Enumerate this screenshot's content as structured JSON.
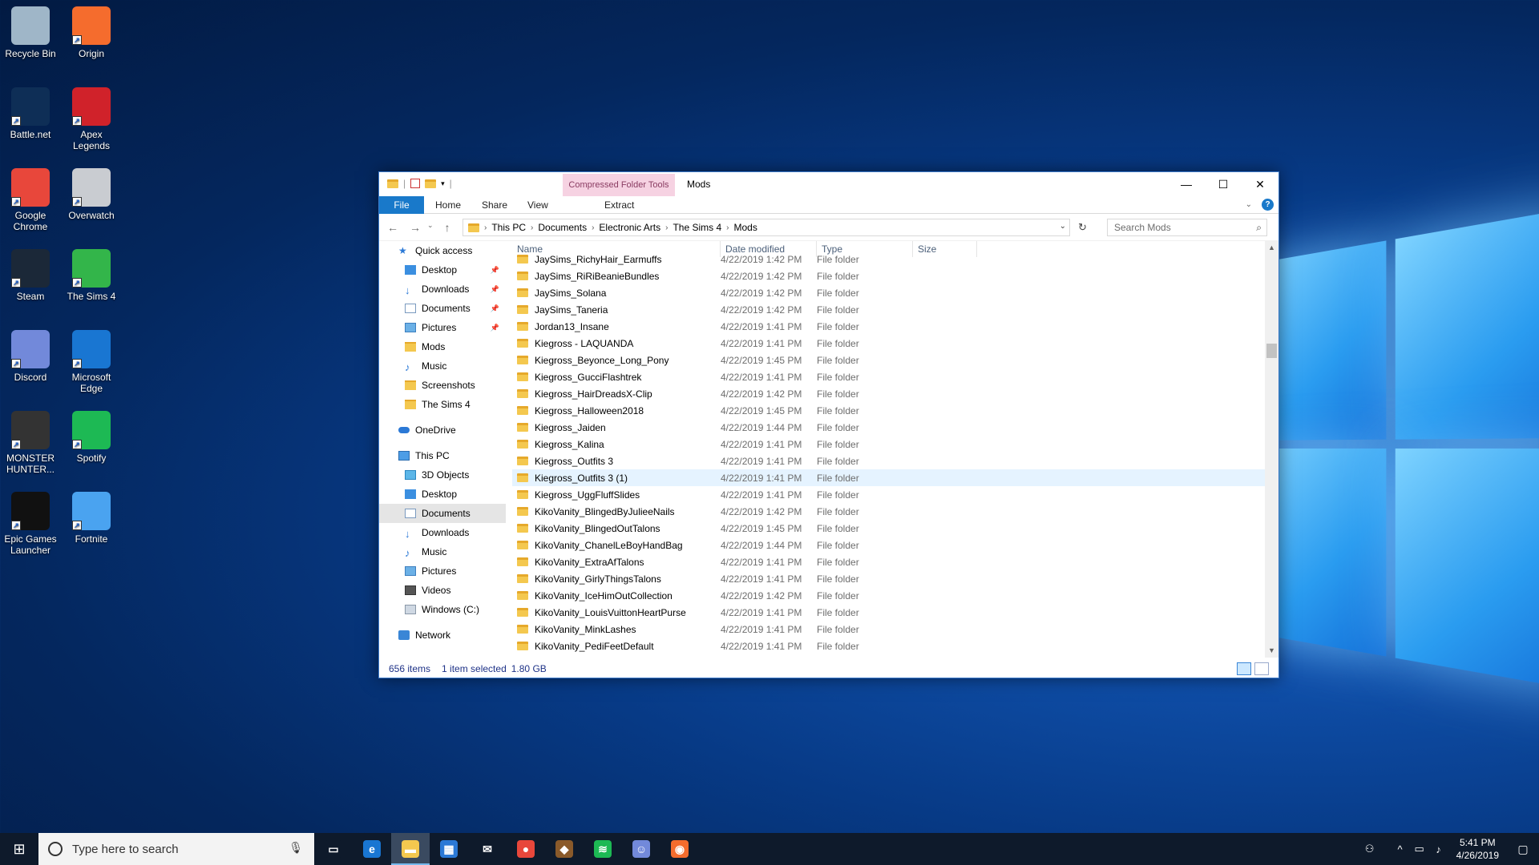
{
  "desktop_icons": [
    {
      "label": "Recycle Bin",
      "icon": "recycle-bin-icon",
      "color": "#9fb6c8"
    },
    {
      "label": "Origin",
      "icon": "origin-icon",
      "color": "#f56c2d"
    },
    {
      "label": "Battle.net",
      "icon": "battlenet-icon",
      "color": "#0e2e56"
    },
    {
      "label": "Apex Legends",
      "icon": "apex-icon",
      "color": "#d0222a"
    },
    {
      "label": "Google Chrome",
      "icon": "chrome-icon",
      "color": "#e8473b"
    },
    {
      "label": "Overwatch",
      "icon": "overwatch-icon",
      "color": "#c9ccd1"
    },
    {
      "label": "Steam",
      "icon": "steam-icon",
      "color": "#1b2838"
    },
    {
      "label": "The Sims 4",
      "icon": "sims-icon",
      "color": "#33b54a"
    },
    {
      "label": "Discord",
      "icon": "discord-icon",
      "color": "#7289da"
    },
    {
      "label": "Microsoft Edge",
      "icon": "edge-icon",
      "color": "#1976d2"
    },
    {
      "label": "MONSTER HUNTER...",
      "icon": "monster-hunter-icon",
      "color": "#333333"
    },
    {
      "label": "Spotify",
      "icon": "spotify-icon",
      "color": "#1db954"
    },
    {
      "label": "Epic Games Launcher",
      "icon": "epic-icon",
      "color": "#111111"
    },
    {
      "label": "Fortnite",
      "icon": "fortnite-icon",
      "color": "#4aa3f0"
    }
  ],
  "window": {
    "title": "Mods",
    "context_tab": "Compressed Folder Tools",
    "tabs": [
      "File",
      "Home",
      "Share",
      "View"
    ],
    "context_subtab": "Extract",
    "address": [
      "This PC",
      "Documents",
      "Electronic Arts",
      "The Sims 4",
      "Mods"
    ],
    "search_placeholder": "Search Mods",
    "columns": [
      "Name",
      "Date modified",
      "Type",
      "Size"
    ],
    "status": {
      "items": "656 items",
      "selected": "1 item selected",
      "size": "1.80 GB"
    }
  },
  "nav": [
    {
      "label": "Quick access",
      "icon": "star",
      "indent": 0
    },
    {
      "label": "Desktop",
      "icon": "blue",
      "indent": 1,
      "pin": true
    },
    {
      "label": "Downloads",
      "icon": "dl",
      "indent": 1,
      "pin": true
    },
    {
      "label": "Documents",
      "icon": "doc",
      "indent": 1,
      "pin": true
    },
    {
      "label": "Pictures",
      "icon": "pic",
      "indent": 1,
      "pin": true
    },
    {
      "label": "Mods",
      "icon": "yellow",
      "indent": 1
    },
    {
      "label": "Music",
      "icon": "music",
      "indent": 1
    },
    {
      "label": "Screenshots",
      "icon": "yellow",
      "indent": 1
    },
    {
      "label": "The Sims 4",
      "icon": "yellow",
      "indent": 1
    },
    {
      "label": "OneDrive",
      "icon": "cloud",
      "indent": 0,
      "gap": true
    },
    {
      "label": "This PC",
      "icon": "pc",
      "indent": 0,
      "gap": true
    },
    {
      "label": "3D Objects",
      "icon": "obj3d",
      "indent": 1
    },
    {
      "label": "Desktop",
      "icon": "blue",
      "indent": 1
    },
    {
      "label": "Documents",
      "icon": "doc",
      "indent": 1,
      "selected": true
    },
    {
      "label": "Downloads",
      "icon": "dl",
      "indent": 1
    },
    {
      "label": "Music",
      "icon": "music",
      "indent": 1
    },
    {
      "label": "Pictures",
      "icon": "pic",
      "indent": 1
    },
    {
      "label": "Videos",
      "icon": "vid",
      "indent": 1
    },
    {
      "label": "Windows (C:)",
      "icon": "drive",
      "indent": 1
    },
    {
      "label": "Network",
      "icon": "net",
      "indent": 0,
      "gap": true
    }
  ],
  "files": [
    {
      "name": "JaySims_RichyHair_Earmuffs",
      "date": "4/22/2019 1:42 PM",
      "type": "File folder"
    },
    {
      "name": "JaySims_RiRiBeanieBundles",
      "date": "4/22/2019 1:42 PM",
      "type": "File folder"
    },
    {
      "name": "JaySims_Solana",
      "date": "4/22/2019 1:42 PM",
      "type": "File folder"
    },
    {
      "name": "JaySims_Taneria",
      "date": "4/22/2019 1:42 PM",
      "type": "File folder"
    },
    {
      "name": "Jordan13_Insane",
      "date": "4/22/2019 1:41 PM",
      "type": "File folder"
    },
    {
      "name": "Kiegross - LAQUANDA",
      "date": "4/22/2019 1:41 PM",
      "type": "File folder"
    },
    {
      "name": "Kiegross_Beyonce_Long_Pony",
      "date": "4/22/2019 1:45 PM",
      "type": "File folder"
    },
    {
      "name": "Kiegross_GucciFlashtrek",
      "date": "4/22/2019 1:41 PM",
      "type": "File folder"
    },
    {
      "name": "Kiegross_HairDreadsX-Clip",
      "date": "4/22/2019 1:42 PM",
      "type": "File folder"
    },
    {
      "name": "Kiegross_Halloween2018",
      "date": "4/22/2019 1:45 PM",
      "type": "File folder"
    },
    {
      "name": "Kiegross_Jaiden",
      "date": "4/22/2019 1:44 PM",
      "type": "File folder"
    },
    {
      "name": "Kiegross_Kalina",
      "date": "4/22/2019 1:41 PM",
      "type": "File folder"
    },
    {
      "name": "Kiegross_Outfits 3",
      "date": "4/22/2019 1:41 PM",
      "type": "File folder"
    },
    {
      "name": "Kiegross_Outfits 3 (1)",
      "date": "4/22/2019 1:41 PM",
      "type": "File folder",
      "highlight": true
    },
    {
      "name": "Kiegross_UggFluffSlides",
      "date": "4/22/2019 1:41 PM",
      "type": "File folder"
    },
    {
      "name": "KikoVanity_BlingedByJulieeNails",
      "date": "4/22/2019 1:42 PM",
      "type": "File folder"
    },
    {
      "name": "KikoVanity_BlingedOutTalons",
      "date": "4/22/2019 1:45 PM",
      "type": "File folder"
    },
    {
      "name": "KikoVanity_ChanelLeBoyHandBag",
      "date": "4/22/2019 1:44 PM",
      "type": "File folder"
    },
    {
      "name": "KikoVanity_ExtraAfTalons",
      "date": "4/22/2019 1:41 PM",
      "type": "File folder"
    },
    {
      "name": "KikoVanity_GirlyThingsTalons",
      "date": "4/22/2019 1:41 PM",
      "type": "File folder"
    },
    {
      "name": "KikoVanity_IceHimOutCollection",
      "date": "4/22/2019 1:42 PM",
      "type": "File folder"
    },
    {
      "name": "KikoVanity_LouisVuittonHeartPurse",
      "date": "4/22/2019 1:41 PM",
      "type": "File folder"
    },
    {
      "name": "KikoVanity_MinkLashes",
      "date": "4/22/2019 1:41 PM",
      "type": "File folder"
    },
    {
      "name": "KikoVanity_PediFeetDefault",
      "date": "4/22/2019 1:41 PM",
      "type": "File folder"
    }
  ],
  "taskbar": {
    "search_placeholder": "Type here to search",
    "time": "5:41 PM",
    "date": "4/26/2019",
    "apps": [
      {
        "icon": "task-view-icon",
        "glyph": "▭",
        "color": "#0e1a2b"
      },
      {
        "icon": "edge-icon",
        "glyph": "e",
        "color": "#1976d2"
      },
      {
        "icon": "file-explorer-icon",
        "glyph": "▬",
        "color": "#f4c84f",
        "active": true
      },
      {
        "icon": "store-icon",
        "glyph": "▦",
        "color": "#2b79d6"
      },
      {
        "icon": "mail-icon",
        "glyph": "✉",
        "color": "#0e1a2b"
      },
      {
        "icon": "chrome-icon",
        "glyph": "●",
        "color": "#e8473b"
      },
      {
        "icon": "mh-icon",
        "glyph": "◆",
        "color": "#8a5a2a"
      },
      {
        "icon": "spotify-icon",
        "glyph": "≋",
        "color": "#1db954"
      },
      {
        "icon": "discord-icon",
        "glyph": "☺",
        "color": "#7289da"
      },
      {
        "icon": "origin-icon",
        "glyph": "◉",
        "color": "#f56c2d"
      }
    ]
  }
}
